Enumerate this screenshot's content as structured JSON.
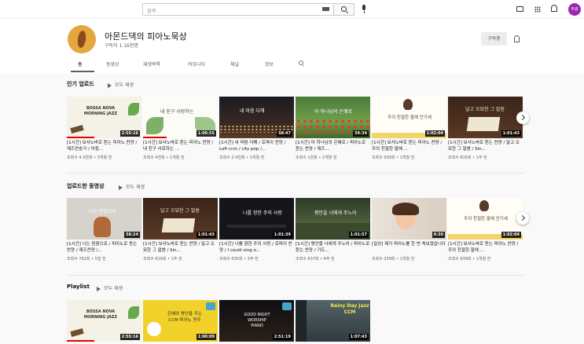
{
  "topbar": {
    "search_placeholder": "검색",
    "avatar_text": "추광"
  },
  "channel": {
    "name": "아몬드댁의 피아노묵상",
    "subscribers": "구독자 1.16천명",
    "subscribe_label": "구독중"
  },
  "tabs": [
    "홈",
    "동영상",
    "재생목록",
    "커뮤니티",
    "채널",
    "정보"
  ],
  "sections": {
    "popular": {
      "title": "인기 업로드",
      "play_all": "모두 재생"
    },
    "uploads": {
      "title": "업로드한 동영상",
      "play_all": "모두 재생"
    },
    "playlist": {
      "title": "Playlist",
      "play_all": "모두 재생"
    }
  },
  "popular_videos": [
    {
      "thumb_text": "BOSSA NOVA MORNING JAZZ",
      "duration": "2:55:16",
      "title": "[1시간] 보사노바로 듣는 피아노 찬양 / 재즈찬송가 / 아침...",
      "meta": "조회수 4.3만회 • 3개월 전"
    },
    {
      "thumb_text": "내 친구 사랑하는",
      "duration": "1:00:55",
      "title": "[1시간] 보사노바로 듣는 피아노 찬양 / 내 친구 사로하는 ...",
      "meta": "조회수 4천회 • 1개월 전"
    },
    {
      "thumb_text": "내 마음 다해",
      "duration": "58:47",
      "title": "[1시간] 내 마음 다해 / 로파이 찬양 / Lofi ccm / city pop /...",
      "meta": "조회수 2.4천회 • 1개월 전"
    },
    {
      "thumb_text": "아 하나님의 은혜로",
      "duration": "59:34",
      "title": "[1시간] 아 하나님의 은혜로 / 피아노로 듣는 찬양 / 재즈...",
      "meta": "조회수 1천회 • 2개월 전"
    },
    {
      "thumb_text": "주의 친절한 팔에 안기세",
      "duration": "1:02:04",
      "title": "[1시간] 보사노바로 듣는 피아노 찬양 / 주의 친절한 팔에 ...",
      "meta": "조회수 939회 • 1개월 전"
    },
    {
      "thumb_text": "달고 오묘한 그 말씀",
      "duration": "1:01:43",
      "title": "[1시간] 보사노바로 듣는 찬양 / 달고 오묘한 그 말씀 / Sin...",
      "meta": "조회수 816회 • 1주 전"
    }
  ],
  "upload_videos": [
    {
      "thumb_text": "나는 믿음으로",
      "duration": "58:24",
      "title": "[1시간] 나는 믿음으로 / 피아노로 듣는 찬양 / 재즈찬양 /...",
      "meta": "조회수 762회 • 5일 전"
    },
    {
      "thumb_text": "달고 오묘한 그 말씀",
      "duration": "1:01:43",
      "title": "[1시간] 보사노바로 듣는 찬양 / 달고 오묘한 그 말씀 / Sin...",
      "meta": "조회수 816회 • 1주 전"
    },
    {
      "thumb_text": "나를 향한 주의 사랑",
      "duration": "1:01:39",
      "title": "[1시간] 나를 향한 주의 사랑 / 로파이 찬양 / I could sing o...",
      "meta": "조회수 635회 • 3주 전"
    },
    {
      "thumb_text": "평안을 너에게 주노라",
      "duration": "1:01:57",
      "title": "[1시간] 평안을 너에게 주노라 / 피아노로 듣는 찬양 / 기도...",
      "meta": "조회수 637회 • 4주 전"
    },
    {
      "thumb_text": "",
      "duration": "0:30",
      "title": "[일상] 제가 피아노를 한 번 쳐보겠습니다",
      "meta": "조회수 259회 • 1개월 전"
    },
    {
      "thumb_text": "주의 친절한 팔에 안기세",
      "duration": "1:02:04",
      "title": "[1시간] 보사노바로 듣는 피아노 찬양 / 주의 친절한 팔에 ...",
      "meta": "조회수 939회 • 1개월 전"
    }
  ],
  "playlist_videos": [
    {
      "thumb_text": "BOSSA NOVA MORNING JAZZ",
      "duration": "2:55:16"
    },
    {
      "thumb_text": "은혜와 평안을 주는 CCM 피아노 연주",
      "duration": "1:00:09"
    },
    {
      "thumb_text": "GOOD NIGHT WORSHIP PIANO",
      "duration": "2:51:19"
    },
    {
      "thumb_text": "Rainy Day Jazz CCM",
      "duration": "1:07:43"
    }
  ]
}
